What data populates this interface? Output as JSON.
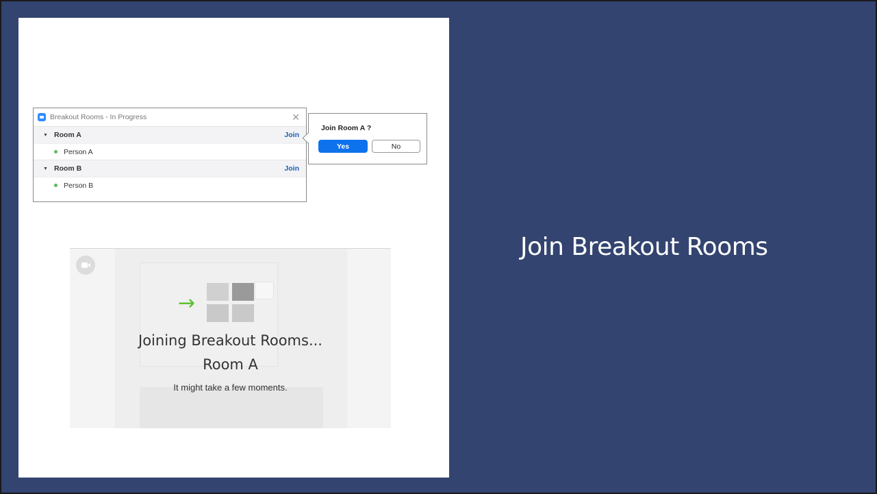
{
  "slide": {
    "title": "Join Breakout Rooms",
    "background_color": "#334470"
  },
  "breakout_window": {
    "title": "Breakout Rooms - In Progress",
    "close_icon": "close-icon",
    "rooms": [
      {
        "name": "Room A",
        "join_label": "Join",
        "participants": [
          "Person A"
        ]
      },
      {
        "name": "Room B",
        "join_label": "Join",
        "participants": [
          "Person B"
        ]
      }
    ]
  },
  "join_prompt": {
    "question": "Join Room A ?",
    "yes_label": "Yes",
    "no_label": "No",
    "yes_color": "#0e72ed"
  },
  "joining_screen": {
    "heading": "Joining Breakout Rooms...",
    "room": "Room A",
    "note": "It might take a few moments.",
    "arrow_glyph": "→",
    "arrow_color": "#5bc236"
  }
}
